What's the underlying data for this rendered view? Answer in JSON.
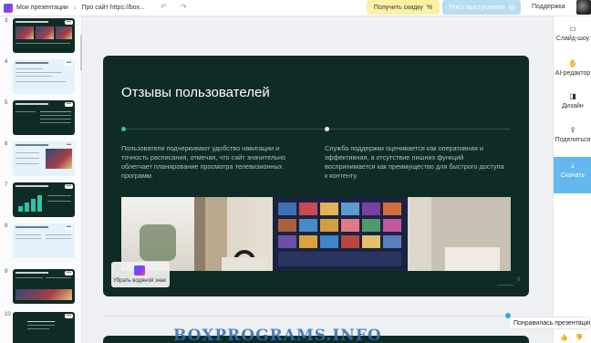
{
  "topbar": {
    "breadcrumb_root": "Мои презентации",
    "breadcrumb_sep": "›",
    "breadcrumb_current": "Про сайт https://box...",
    "undo_icon": "undo-icon",
    "redo_icon": "redo-icon",
    "discount_label": "Получить скидку",
    "discount_icon": "%",
    "speech_label": "Текст выступления",
    "support_label": "Поддержка"
  },
  "thumbnails": [
    {
      "num": "3",
      "style": "dark"
    },
    {
      "num": "4",
      "style": "light"
    },
    {
      "num": "5",
      "style": "dark"
    },
    {
      "num": "6",
      "style": "light"
    },
    {
      "num": "7",
      "style": "dark"
    },
    {
      "num": "8",
      "style": "light"
    },
    {
      "num": "9",
      "style": "dark"
    },
    {
      "num": "10",
      "style": "dark"
    }
  ],
  "thumb_menu": "•••",
  "slide": {
    "title": "Отзывы пользователей",
    "col1": "Пользователи подчеркивают удобство навигации и точность расписания, отмечая, что сайт значительно облегчает планирование просмотра телевизионных программ.",
    "col2": "Служба поддержки оценивается как оперативная и эффективная, а отсутствие лишних функций воспринимается как преимущество для быстрого доступа к контенту.",
    "page_number": "9"
  },
  "watermark_button": "Убрать водяной знак",
  "right_panel": [
    {
      "label": "Слайд-шоу",
      "icon": "▭"
    },
    {
      "label": "AI-редактор",
      "icon": "✋"
    },
    {
      "label": "Дизайн",
      "icon": "◨"
    },
    {
      "label": "Поделиться",
      "icon": "⇪"
    },
    {
      "label": "Скачать",
      "icon": "⤓"
    }
  ],
  "feedback": {
    "question": "Понравилась презентация?",
    "like_icon": "👍",
    "dislike_icon": "👎"
  },
  "overlay_watermark": "BOXPROGRAMS.INFO"
}
